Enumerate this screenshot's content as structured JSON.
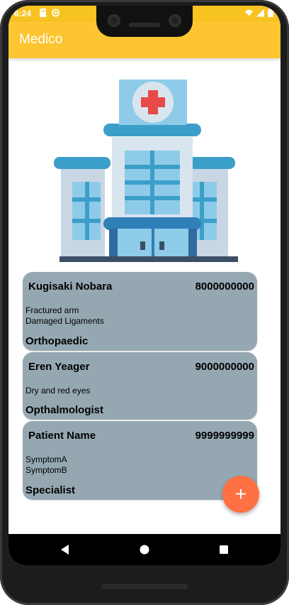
{
  "status_bar": {
    "time": "6:24"
  },
  "app_bar": {
    "title": "Medico",
    "color": "#fdc530"
  },
  "patients": [
    {
      "name": "Kugisaki Nobara",
      "phone": "8000000000",
      "symptoms": [
        "Fractured arm",
        "Damaged Ligaments"
      ],
      "specialist": "Orthopaedic"
    },
    {
      "name": "Eren Yeager",
      "phone": "9000000000",
      "symptoms": [
        "Dry and red eyes"
      ],
      "specialist": "Opthalmologist"
    },
    {
      "name": "Patient Name",
      "phone": "9999999999",
      "symptoms": [
        "SymptomA",
        "SymptomB"
      ],
      "specialist": "Specialist"
    }
  ],
  "fab": {
    "icon": "plus-icon",
    "label": "+",
    "color": "#ff7043"
  },
  "card_color": "#95a8b2",
  "nav": {
    "back_icon": "back-triangle-icon",
    "home_icon": "home-circle-icon",
    "recent_icon": "recents-square-icon"
  }
}
